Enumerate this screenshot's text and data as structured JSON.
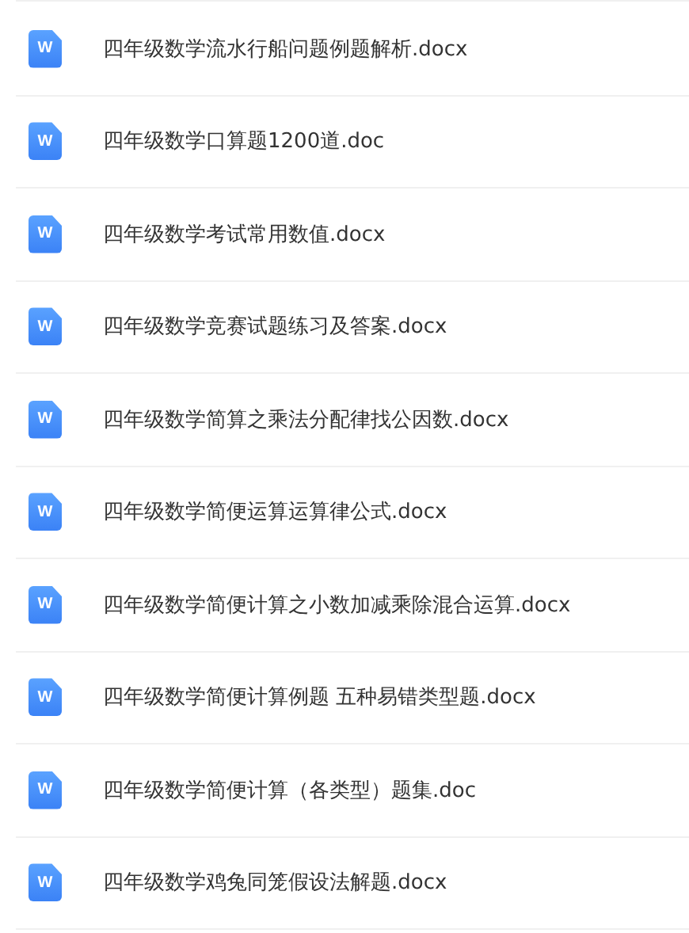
{
  "files": [
    {
      "name": "四年级数学流水行船问题例题解析.docx",
      "icon_letter": "W"
    },
    {
      "name": "四年级数学口算题1200道.doc",
      "icon_letter": "W"
    },
    {
      "name": "四年级数学考试常用数值.docx",
      "icon_letter": "W"
    },
    {
      "name": "四年级数学竞赛试题练习及答案.docx",
      "icon_letter": "W"
    },
    {
      "name": "四年级数学简算之乘法分配律找公因数.docx",
      "icon_letter": "W"
    },
    {
      "name": "四年级数学简便运算运算律公式.docx",
      "icon_letter": "W"
    },
    {
      "name": "四年级数学简便计算之小数加减乘除混合运算.docx",
      "icon_letter": "W"
    },
    {
      "name": "四年级数学简便计算例题 五种易错类型题.docx",
      "icon_letter": "W"
    },
    {
      "name": "四年级数学简便计算（各类型）题集.doc",
      "icon_letter": "W"
    },
    {
      "name": "四年级数学鸡兔同笼假设法解题.docx",
      "icon_letter": "W"
    }
  ]
}
